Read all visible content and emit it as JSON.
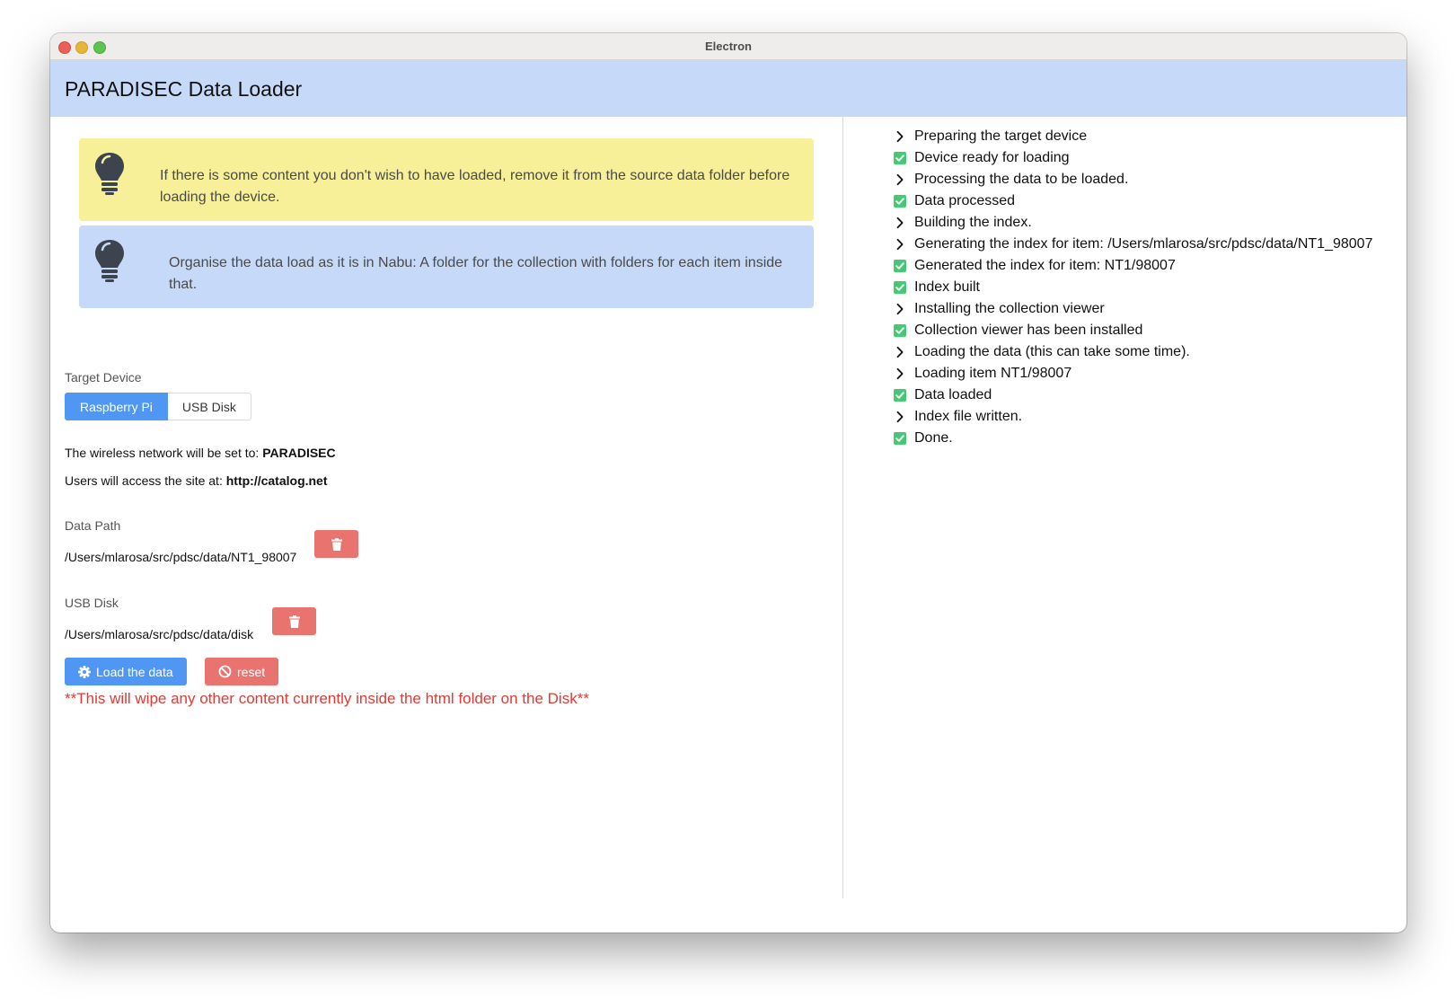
{
  "window": {
    "title": "Electron"
  },
  "app": {
    "title": "PARADISEC Data Loader"
  },
  "notices": {
    "tip1": "If there is some content you don't wish to have loaded, remove it from the source data folder before loading the device.",
    "tip2": "Organise the data load as it is in Nabu: A folder for the collection with folders for each item inside that."
  },
  "target": {
    "label": "Target Device",
    "options": [
      "Raspberry Pi",
      "USB Disk"
    ],
    "selected": "Raspberry Pi",
    "wireless_prefix": "The wireless network will be set to: ",
    "wireless_value": "PARADISEC",
    "site_prefix": "Users will access the site at: ",
    "site_value": "http://catalog.net"
  },
  "data_path": {
    "label": "Data Path",
    "value": "/Users/mlarosa/src/pdsc/data/NT1_98007"
  },
  "usb_disk": {
    "label": "USB Disk",
    "value": "/Users/mlarosa/src/pdsc/data/disk"
  },
  "actions": {
    "load_label": "Load the data",
    "reset_label": "reset"
  },
  "warning": "**This will wipe any other content currently inside the html folder on the Disk**",
  "colors": {
    "header": "#c6d9f8",
    "yellow_notice": "#f8ef99",
    "primary": "#4f97f3",
    "danger": "#e8736f",
    "success": "#48c774",
    "warning_text": "#e03a33"
  },
  "log": [
    {
      "icon": "chevron-right-icon",
      "text": "Preparing the target device"
    },
    {
      "icon": "check-icon",
      "text": "Device ready for loading"
    },
    {
      "icon": "chevron-right-icon",
      "text": "Processing the data to be loaded."
    },
    {
      "icon": "check-icon",
      "text": "Data processed"
    },
    {
      "icon": "chevron-right-icon",
      "text": "Building the index."
    },
    {
      "icon": "chevron-right-icon",
      "text": "Generating the index for item: /Users/mlarosa/src/pdsc/data/NT1_98007"
    },
    {
      "icon": "check-icon",
      "text": "Generated the index for item: NT1/98007"
    },
    {
      "icon": "check-icon",
      "text": "Index built"
    },
    {
      "icon": "chevron-right-icon",
      "text": "Installing the collection viewer"
    },
    {
      "icon": "check-icon",
      "text": "Collection viewer has been installed"
    },
    {
      "icon": "chevron-right-icon",
      "text": "Loading the data (this can take some time)."
    },
    {
      "icon": "chevron-right-icon",
      "text": "Loading item NT1/98007"
    },
    {
      "icon": "check-icon",
      "text": "Data loaded"
    },
    {
      "icon": "chevron-right-icon",
      "text": "Index file written."
    },
    {
      "icon": "check-icon",
      "text": "Done."
    }
  ]
}
